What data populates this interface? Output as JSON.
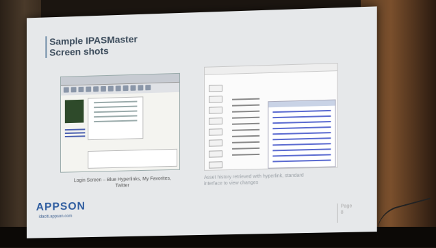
{
  "slide": {
    "title_line1": "Sample IPASMaster",
    "title_line2": "Screen shots",
    "caption_left_line1": "Login Screen – Blue Hyperlinks, My Favorites,",
    "caption_left_line2": "Twitter",
    "caption_right_line1": "Asset history retrieved with hyperlink, standard",
    "caption_right_line2": "interface to view changes",
    "logo_text": "APPSON",
    "website": "idaciti.appson.com",
    "page_label": "Page",
    "page_number": "8"
  },
  "colors": {
    "title": "#3a4a5a",
    "logo": "#2f5da0",
    "screen_bg": "#e6e8ea"
  }
}
